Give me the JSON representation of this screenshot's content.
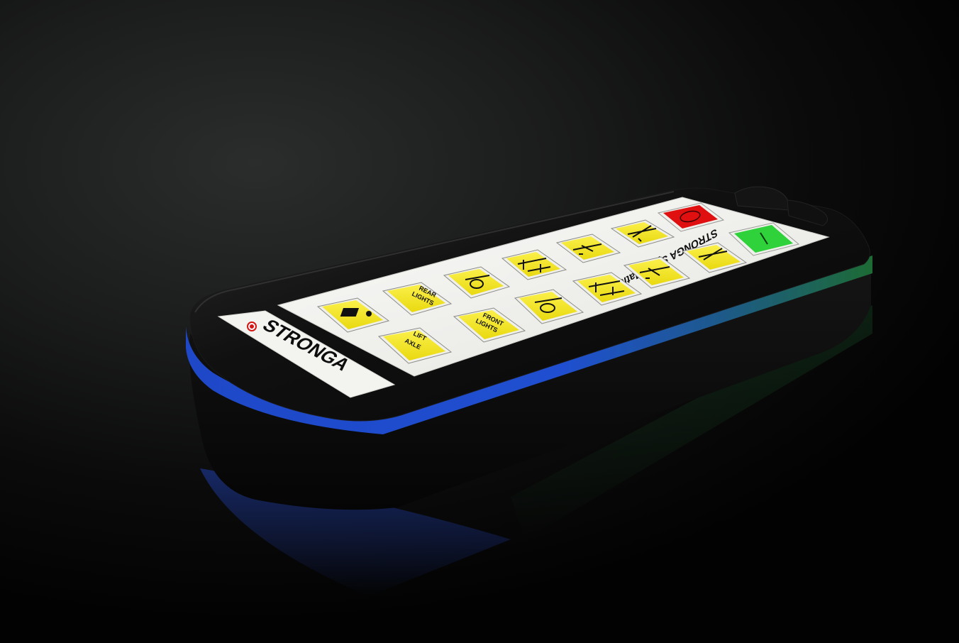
{
  "brand": {
    "name": "STRONGA",
    "product_mark": "STRONGA SystaMatic"
  },
  "buttons": {
    "stop": {
      "color": "#e01010",
      "icon": "circle-icon"
    },
    "start": {
      "color": "#2fd23a",
      "icon": "line-icon"
    },
    "rear_lights": {
      "line1": "REAR",
      "line2": "LIGHTS"
    },
    "front_lights": {
      "line1": "FRONT",
      "line2": "LIGHTS"
    },
    "lift_axle": {
      "line1": "LIFT",
      "line2": "AXLE"
    },
    "pictogram_keys": [
      "trailer-hitch-icon",
      "landing-leg-icon",
      "axle-raise-icon",
      "tipper-icon",
      "axle-lower-icon",
      "landing-leg-icon",
      "trailer-tip-icon",
      "tipper-icon",
      "trailer-tip-icon"
    ]
  },
  "colors": {
    "key_yellow": "#f4e81a",
    "faceplate": "#f2f2ef",
    "bezel": "#0c0c0c",
    "blue_band": "#1f4fd0",
    "green_band": "#1d6b35"
  }
}
